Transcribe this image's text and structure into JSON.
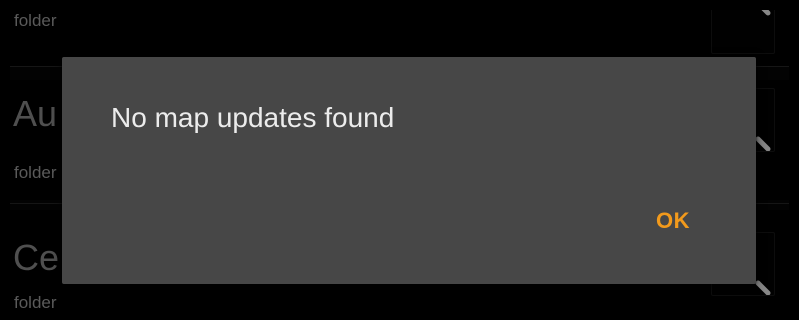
{
  "list": {
    "rows": [
      {
        "title": "",
        "subtitle": "folder",
        "button_icon": "search-icon"
      },
      {
        "title": "Au",
        "subtitle": "folder",
        "button_icon": "search-icon"
      },
      {
        "title": "Ce",
        "subtitle": "folder",
        "button_icon": "search-icon"
      }
    ]
  },
  "dialog": {
    "message": "No map updates found",
    "ok_label": "OK"
  },
  "colors": {
    "background": "#000000",
    "dialog_background": "#474747",
    "dialog_text": "#ececec",
    "accent": "#f29a1c",
    "row_text": "#7a7a7a"
  }
}
